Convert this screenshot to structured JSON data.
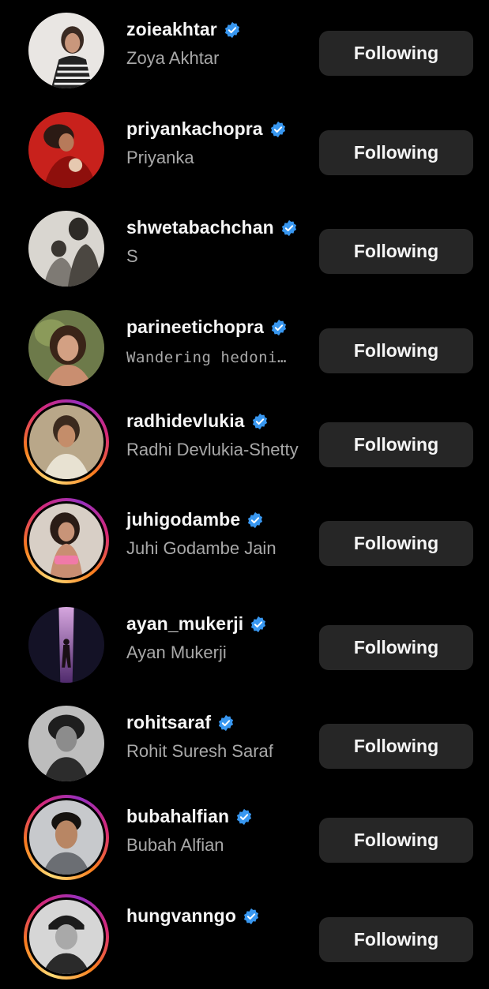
{
  "colors": {
    "background": "#000000",
    "button_bg": "#262626",
    "verified_blue": "#3897f0",
    "secondary_text": "#a8a8a8"
  },
  "accounts": [
    {
      "username": "zoieakhtar",
      "full_name": "Zoya Akhtar",
      "verified": true,
      "has_story": false,
      "button": "Following",
      "avatar_icon": "profile-photo"
    },
    {
      "username": "priyankachopra",
      "full_name": "Priyanka",
      "verified": true,
      "has_story": false,
      "button": "Following",
      "avatar_icon": "profile-photo"
    },
    {
      "username": "shwetabachchan",
      "full_name": "S",
      "verified": true,
      "has_story": false,
      "button": "Following",
      "avatar_icon": "profile-photo"
    },
    {
      "username": "parineetichopra",
      "full_name": "Wandering hedoni…",
      "verified": true,
      "has_story": false,
      "button": "Following",
      "avatar_icon": "profile-photo"
    },
    {
      "username": "radhidevlukia",
      "full_name": "Radhi Devlukia-Shetty",
      "verified": true,
      "has_story": true,
      "button": "Following",
      "avatar_icon": "profile-photo"
    },
    {
      "username": "juhigodambe",
      "full_name": "Juhi Godambe Jain",
      "verified": true,
      "has_story": true,
      "button": "Following",
      "avatar_icon": "profile-photo"
    },
    {
      "username": "ayan_mukerji",
      "full_name": "Ayan Mukerji",
      "verified": true,
      "has_story": false,
      "button": "Following",
      "avatar_icon": "profile-photo"
    },
    {
      "username": "rohitsaraf",
      "full_name": "Rohit Suresh Saraf",
      "verified": true,
      "has_story": false,
      "button": "Following",
      "avatar_icon": "profile-photo"
    },
    {
      "username": "bubahalfian",
      "full_name": "Bubah Alfian",
      "verified": true,
      "has_story": true,
      "button": "Following",
      "avatar_icon": "profile-photo"
    },
    {
      "username": "hungvanngo",
      "full_name": "",
      "verified": true,
      "has_story": true,
      "button": "Following",
      "avatar_icon": "profile-photo"
    }
  ]
}
